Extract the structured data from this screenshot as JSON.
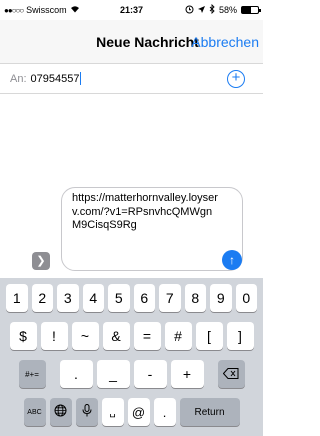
{
  "status_bar": {
    "signal": "●●○○○",
    "carrier": "Swisscom",
    "wifi_icon": "wifi-icon",
    "time": "21:37",
    "battery_percent": "58%",
    "battery_level": 0.58
  },
  "nav": {
    "title": "Neue Nachricht",
    "cancel_label": "Abbrechen"
  },
  "recipient": {
    "label": "An:",
    "value": "07954557"
  },
  "composer": {
    "message": "https://matterhornvalley.loyserv.com/?v1=RPsnvhcQMWgnM9CisqS9Rg",
    "expand_icon": "chevron-right-icon",
    "send_icon": "arrow-up-icon"
  },
  "keyboard": {
    "row1": [
      "1",
      "2",
      "3",
      "4",
      "5",
      "6",
      "7",
      "8",
      "9",
      "0"
    ],
    "row2": [
      "$",
      "!",
      "~",
      "&",
      "=",
      "#",
      "[",
      "]"
    ],
    "row3_left": "#+=",
    "row3_keys": [
      ".",
      "_",
      "-",
      "+"
    ],
    "row3_delete_icon": "delete-icon",
    "row4": {
      "abc": "ABC",
      "globe_icon": "globe-icon",
      "mic_icon": "microphone-icon",
      "space": "␣",
      "at": "@",
      "dot": ".",
      "return": "Return"
    }
  },
  "colors": {
    "accent": "#1b7cf2",
    "keyboard_bg": "#d1d5db",
    "key_bg": "#ffffff",
    "fn_key_bg": "#adb3bc"
  }
}
